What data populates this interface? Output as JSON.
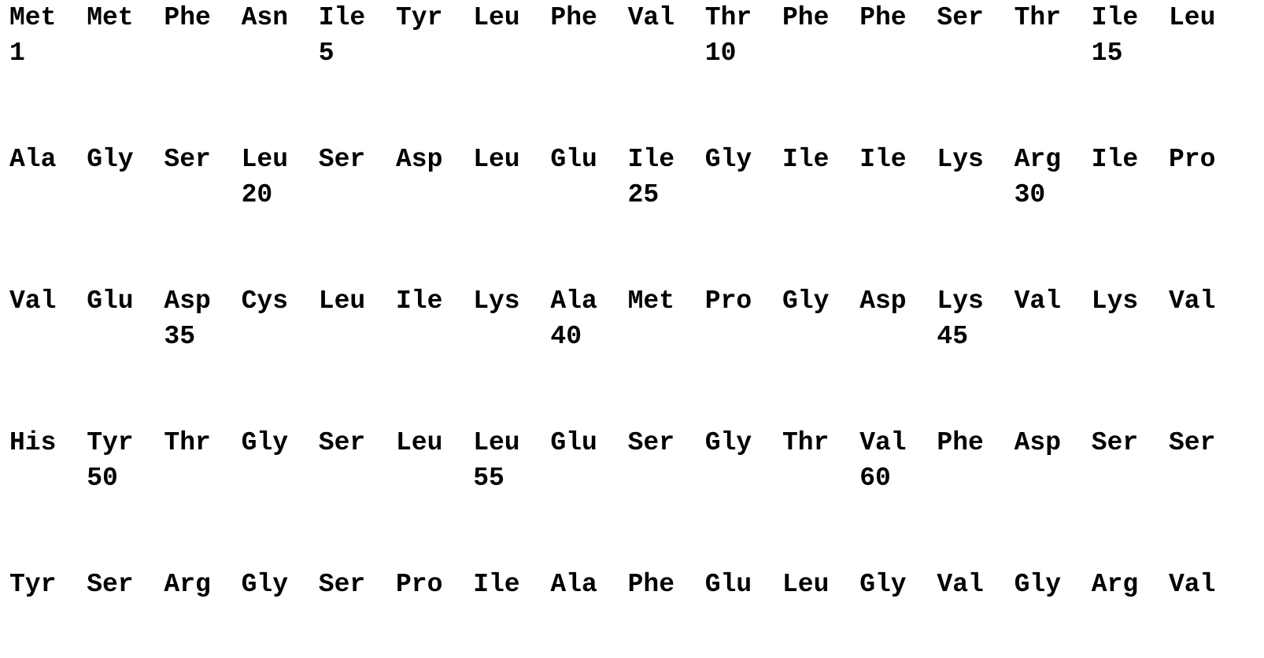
{
  "sequence_rows": [
    {
      "residues": [
        "Met",
        "Met",
        "Phe",
        "Asn",
        "Ile",
        "Tyr",
        "Leu",
        "Phe",
        "Val",
        "Thr",
        "Phe",
        "Phe",
        "Ser",
        "Thr",
        "Ile",
        "Leu"
      ],
      "numbers": [
        {
          "col": 0,
          "label": "1"
        },
        {
          "col": 4,
          "label": "5"
        },
        {
          "col": 9,
          "label": "10"
        },
        {
          "col": 14,
          "label": "15"
        }
      ]
    },
    {
      "residues": [
        "Ala",
        "Gly",
        "Ser",
        "Leu",
        "Ser",
        "Asp",
        "Leu",
        "Glu",
        "Ile",
        "Gly",
        "Ile",
        "Ile",
        "Lys",
        "Arg",
        "Ile",
        "Pro"
      ],
      "numbers": [
        {
          "col": 3,
          "label": "20"
        },
        {
          "col": 8,
          "label": "25"
        },
        {
          "col": 13,
          "label": "30"
        }
      ]
    },
    {
      "residues": [
        "Val",
        "Glu",
        "Asp",
        "Cys",
        "Leu",
        "Ile",
        "Lys",
        "Ala",
        "Met",
        "Pro",
        "Gly",
        "Asp",
        "Lys",
        "Val",
        "Lys",
        "Val"
      ],
      "numbers": [
        {
          "col": 2,
          "label": "35"
        },
        {
          "col": 7,
          "label": "40"
        },
        {
          "col": 12,
          "label": "45"
        }
      ]
    },
    {
      "residues": [
        "His",
        "Tyr",
        "Thr",
        "Gly",
        "Ser",
        "Leu",
        "Leu",
        "Glu",
        "Ser",
        "Gly",
        "Thr",
        "Val",
        "Phe",
        "Asp",
        "Ser",
        "Ser"
      ],
      "numbers": [
        {
          "col": 1,
          "label": "50"
        },
        {
          "col": 6,
          "label": "55"
        },
        {
          "col": 11,
          "label": "60"
        }
      ]
    },
    {
      "residues": [
        "Tyr",
        "Ser",
        "Arg",
        "Gly",
        "Ser",
        "Pro",
        "Ile",
        "Ala",
        "Phe",
        "Glu",
        "Leu",
        "Gly",
        "Val",
        "Gly",
        "Arg",
        "Val"
      ],
      "numbers": []
    }
  ]
}
